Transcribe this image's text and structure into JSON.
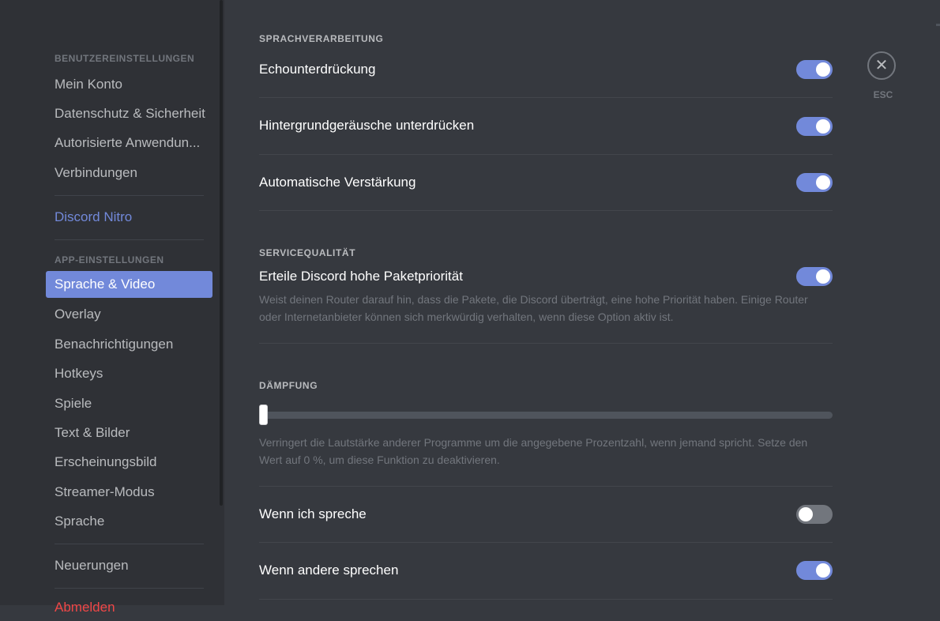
{
  "sidebar": {
    "user_settings_header": "BENUTZEREINSTELLUNGEN",
    "user_items": [
      "Mein Konto",
      "Datenschutz & Sicherheit",
      "Autorisierte Anwendun...",
      "Verbindungen"
    ],
    "nitro": "Discord Nitro",
    "app_settings_header": "APP-EINSTELLUNGEN",
    "app_items": [
      "Sprache & Video",
      "Overlay",
      "Benachrichtigungen",
      "Hotkeys",
      "Spiele",
      "Text & Bilder",
      "Erscheinungsbild",
      "Streamer-Modus",
      "Sprache"
    ],
    "active_item": "Sprache & Video",
    "changelog": "Neuerungen",
    "logout_partial": "Abmelden"
  },
  "main": {
    "voice_processing": {
      "title": "SPRACHVERARBEITUNG",
      "rows": [
        {
          "label": "Echounterdrückung",
          "enabled": true
        },
        {
          "label": "Hintergrundgeräusche unterdrücken",
          "enabled": true
        },
        {
          "label": "Automatische Verstärkung",
          "enabled": true
        }
      ]
    },
    "qos": {
      "title": "SERVICEQUALITÄT",
      "label": "Erteile Discord hohe Paketpriorität",
      "enabled": true,
      "description": "Weist deinen Router darauf hin, dass die Pakete, die Discord überträgt, eine hohe Priorität haben. Einige Router oder Internetanbieter können sich merkwürdig verhalten, wenn diese Option aktiv ist."
    },
    "attenuation": {
      "title": "DÄMPFUNG",
      "value_percent": 0,
      "description": "Verringert die Lautstärke anderer Programme um die angegebene Prozentzahl, wenn jemand spricht. Setze den Wert auf 0 %, um diese Funktion zu deaktivieren.",
      "rows": [
        {
          "label": "Wenn ich spreche",
          "enabled": false
        },
        {
          "label": "Wenn andere sprechen",
          "enabled": true
        }
      ]
    }
  },
  "close": {
    "icon": "close-icon",
    "glyph": "✕",
    "label": "ESC"
  },
  "colors": {
    "accent": "#7289da",
    "background": "#36393f",
    "sidebar": "#2f3136",
    "danger": "#f04747"
  }
}
